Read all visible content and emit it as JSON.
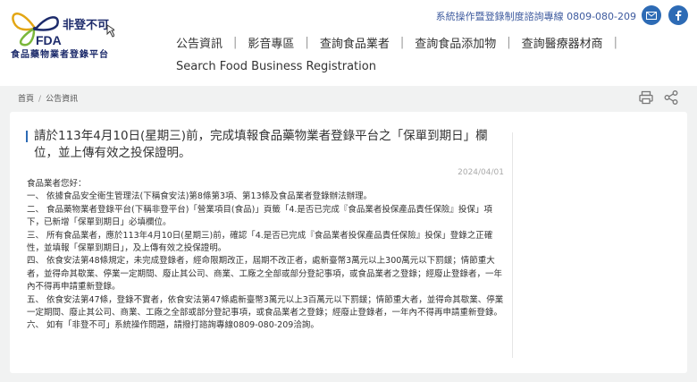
{
  "header": {
    "logo_text": "非登不可",
    "logo_sub": "FDA",
    "logo_name": "食品藥物業者登錄平台",
    "hotline": "系統操作暨登錄制度諮詢專線 0809-080-209"
  },
  "nav": {
    "items": [
      {
        "label": "公告資訊"
      },
      {
        "label": "影音專區"
      },
      {
        "label": "查詢食品業者"
      },
      {
        "label": "查詢食品添加物"
      },
      {
        "label": "查詢醫療器材商"
      }
    ],
    "sep": "|",
    "second_line": "Search Food Business Registration"
  },
  "breadcrumb": {
    "home": "首頁",
    "sep": "/",
    "current": "公告資訊"
  },
  "article": {
    "title": "請於113年4月10日(星期三)前，完成填報食品藥物業者登錄平台之「保單到期日」欄位，並上傳有效之投保證明。",
    "date": "2024/04/01",
    "paragraphs": [
      "食品業者您好：",
      "一、 依據食品安全衛生管理法(下稱食安法)第8條第3項、第13條及食品業者登錄辦法辦理。",
      "二、 食品藥物業者登錄平台(下稱非登平台)「營業項目(食品)」頁籤「4.是否已完成『食品業者投保產品責任保險』投保」項下，已新增「保單到期日」必填欄位。",
      "三、 所有食品業者，應於113年4月10日(星期三)前，確認「4.是否已完成『食品業者投保產品責任保險』投保」登錄之正確性，並填報「保單到期日」，及上傳有效之投保證明。",
      "四、 依食安法第48條規定，未完成登錄者，經命限期改正，屆期不改正者，處新臺幣3萬元以上300萬元以下罰鍰；情節重大者，並得命其歇業、停業一定期間、廢止其公司、商業、工廠之全部或部分登記事項，或食品業者之登錄；經廢止登錄者，一年內不得再申請重新登錄。",
      "五、 依食安法第47條，登錄不實者，依食安法第47條處新臺幣3萬元以上3百萬元以下罰鍰；情節重大者，並得命其歇業、停業一定期間、廢止其公司、商業、工廠之全部或部分登記事項，或食品業者之登錄；經廢止登錄者，一年內不得再申請重新登錄。",
      "六、 如有「非登不可」系統操作問題，請撥打諮詢專線0809-080-209洽詢。"
    ]
  },
  "icons": {
    "mail": "mail-icon",
    "facebook": "facebook-icon",
    "print": "print-icon",
    "share": "share-icon"
  },
  "colors": {
    "brand_blue": "#2d6bb5",
    "hotline_blue": "#3d5a9e",
    "logo_navy": "#1d2b6b",
    "background": "#f1f2f2"
  }
}
